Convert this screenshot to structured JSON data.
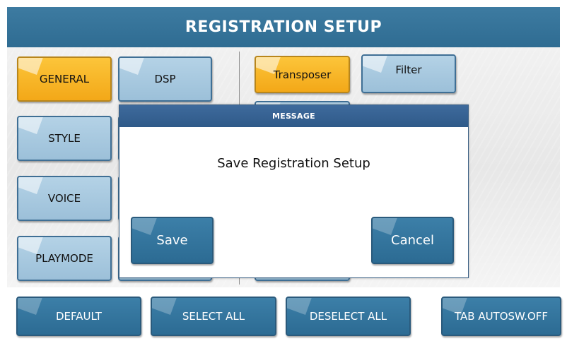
{
  "header": {
    "title": "REGISTRATION SETUP"
  },
  "left_buttons": {
    "general": "GENERAL",
    "dsp": "DSP",
    "style": "STYLE",
    "voice": "VOICE",
    "playmode": "PLAYMODE"
  },
  "right_buttons": {
    "transposer": "Transposer",
    "filter": "Filter"
  },
  "dialog": {
    "title": "MESSAGE",
    "message": "Save Registration Setup",
    "save": "Save",
    "cancel": "Cancel"
  },
  "footer": {
    "default": "DEFAULT",
    "select_all": "SELECT ALL",
    "deselect_all": "DESELECT ALL",
    "tab_autosw": "TAB AUTOSW.OFF"
  },
  "colors": {
    "header": "#3d7ba1",
    "selected": "#f3a818",
    "button_light": "#9cc0d9",
    "button_dark": "#2c6b93",
    "dialog_title": "#2f5a89"
  }
}
